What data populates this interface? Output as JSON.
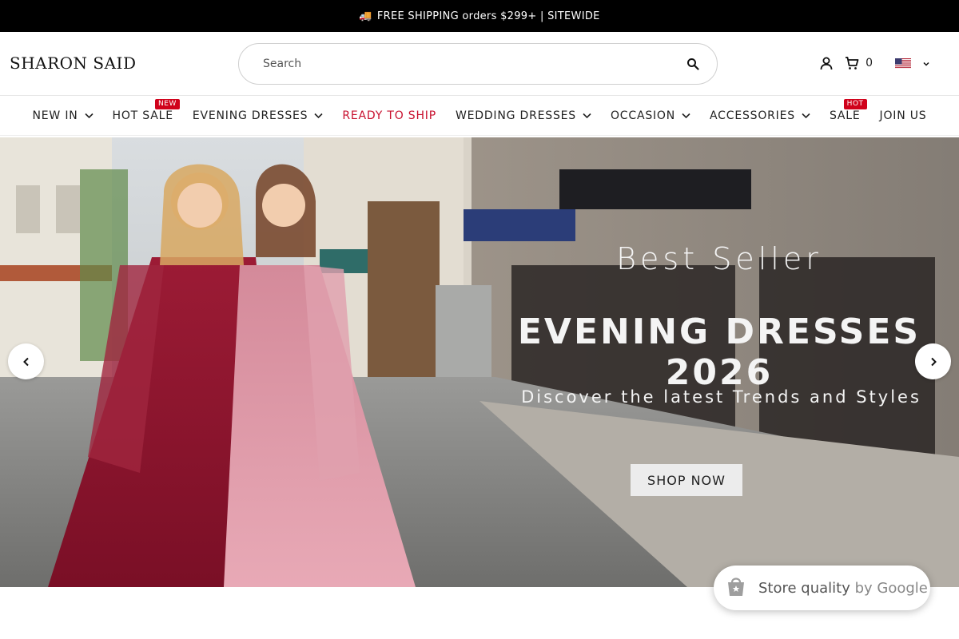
{
  "announcement": {
    "text": "FREE SHIPPING orders $299+ | SITEWIDE",
    "icon": "truck-icon"
  },
  "header": {
    "logo": "SHARON SAID",
    "search_placeholder": "Search",
    "cart_count": "0",
    "country": "US"
  },
  "nav": {
    "items": [
      {
        "label": "NEW IN",
        "dropdown": true
      },
      {
        "label": "HOT SALE",
        "badge": "NEW"
      },
      {
        "label": "EVENING DRESSES",
        "dropdown": true
      },
      {
        "label": "READY TO SHIP",
        "color": "#c8102e"
      },
      {
        "label": "WEDDING DRESSES",
        "dropdown": true
      },
      {
        "label": "OCCASION",
        "dropdown": true
      },
      {
        "label": "ACCESSORIES",
        "dropdown": true
      },
      {
        "label": "SALE",
        "badge": "HOT"
      },
      {
        "label": "JOIN US"
      }
    ]
  },
  "hero": {
    "kicker": "Best Seller",
    "title": "EVENING DRESSES 2026",
    "subtitle": "Discover the latest Trends and Styles",
    "cta": "SHOP NOW"
  },
  "google_badge": {
    "text": "Store quality",
    "by": "by Google"
  },
  "colors": {
    "accent_red": "#c8102e",
    "badge_red": "#d0021b",
    "announce_bg": "#000000"
  }
}
